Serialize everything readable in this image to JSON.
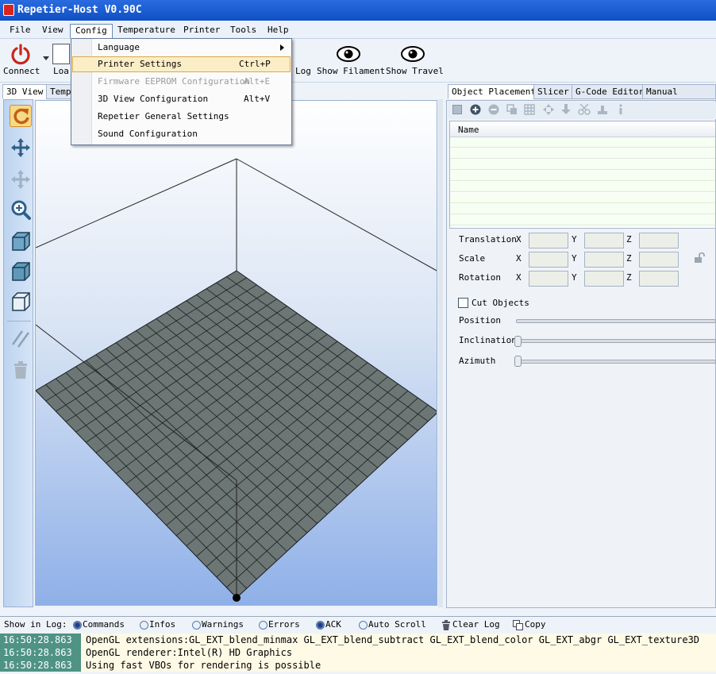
{
  "window": {
    "title": "Repetier-Host V0.90C"
  },
  "menubar": {
    "items": [
      "File",
      "View",
      "Config",
      "Temperature",
      "Printer",
      "Tools",
      "Help"
    ],
    "active": "Config"
  },
  "toolbar": {
    "connect_label": "Connect",
    "load_label": "Loa",
    "log_label": "Log",
    "show_filament_label": "Show Filament",
    "show_travel_label": "Show Travel"
  },
  "config_menu": [
    {
      "label": "Language",
      "shortcut": "",
      "submenu": true,
      "state": "normal"
    },
    {
      "label": "Printer Settings",
      "shortcut": "Ctrl+P",
      "state": "highlighted"
    },
    {
      "label": "Firmware EEPROM Configuration",
      "shortcut": "Alt+E",
      "state": "disabled"
    },
    {
      "label": "3D View Configuration",
      "shortcut": "Alt+V",
      "state": "normal"
    },
    {
      "label": "Repetier General Settings",
      "shortcut": "",
      "state": "normal"
    },
    {
      "label": "Sound Configuration",
      "shortcut": "",
      "state": "normal"
    }
  ],
  "view_tabs": [
    "3D View",
    "Temp"
  ],
  "right_tabs": [
    "Object Placement",
    "Slicer",
    "G-Code Editor",
    "Manual Control"
  ],
  "object_list": {
    "column": "Name"
  },
  "transform": {
    "rows": [
      "Translation",
      "Scale",
      "Rotation"
    ],
    "axes": [
      "X",
      "Y",
      "Z"
    ]
  },
  "cut": {
    "checkbox_label": "Cut Objects",
    "sliders": [
      "Position",
      "Inclination",
      "Azimuth"
    ]
  },
  "log": {
    "show_label": "Show in Log:",
    "filters": [
      {
        "label": "Commands",
        "on": true
      },
      {
        "label": "Infos",
        "on": false
      },
      {
        "label": "Warnings",
        "on": false
      },
      {
        "label": "Errors",
        "on": false
      },
      {
        "label": "ACK",
        "on": true
      },
      {
        "label": "Auto Scroll",
        "on": false
      }
    ],
    "clear_label": "Clear Log",
    "copy_label": "Copy",
    "entries": [
      {
        "time": "16:50:28.863",
        "text": "OpenGL extensions:GL_EXT_blend_minmax GL_EXT_blend_subtract GL_EXT_blend_color GL_EXT_abgr GL_EXT_texture3D"
      },
      {
        "time": "16:50:28.863",
        "text": "OpenGL renderer:Intel(R) HD Graphics"
      },
      {
        "time": "16:50:28.863",
        "text": "Using fast VBOs for rendering is possible"
      }
    ]
  },
  "colors": {
    "title_bar": "#1a5fd6",
    "bed": "#6c7674",
    "log_time_bg": "#4f9384",
    "menu_highlight": "#fbeec7"
  }
}
